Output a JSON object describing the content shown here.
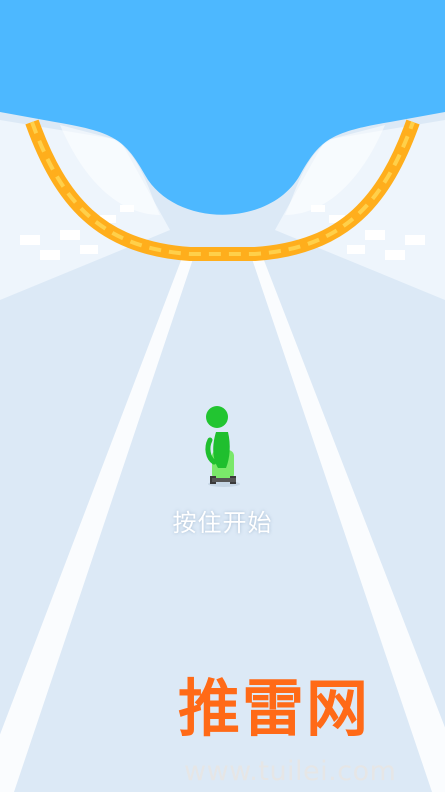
{
  "game": {
    "start_hint": "按住开始"
  },
  "watermark": {
    "title": "推雷网",
    "url": "www.tuilei.com"
  },
  "colors": {
    "sky": "#4db8ff",
    "track": "#dbe9f6",
    "rail": "#ffb01f",
    "player": "#1fbf2e",
    "board": "#6ef06a",
    "watermark": "#ff6a17"
  }
}
